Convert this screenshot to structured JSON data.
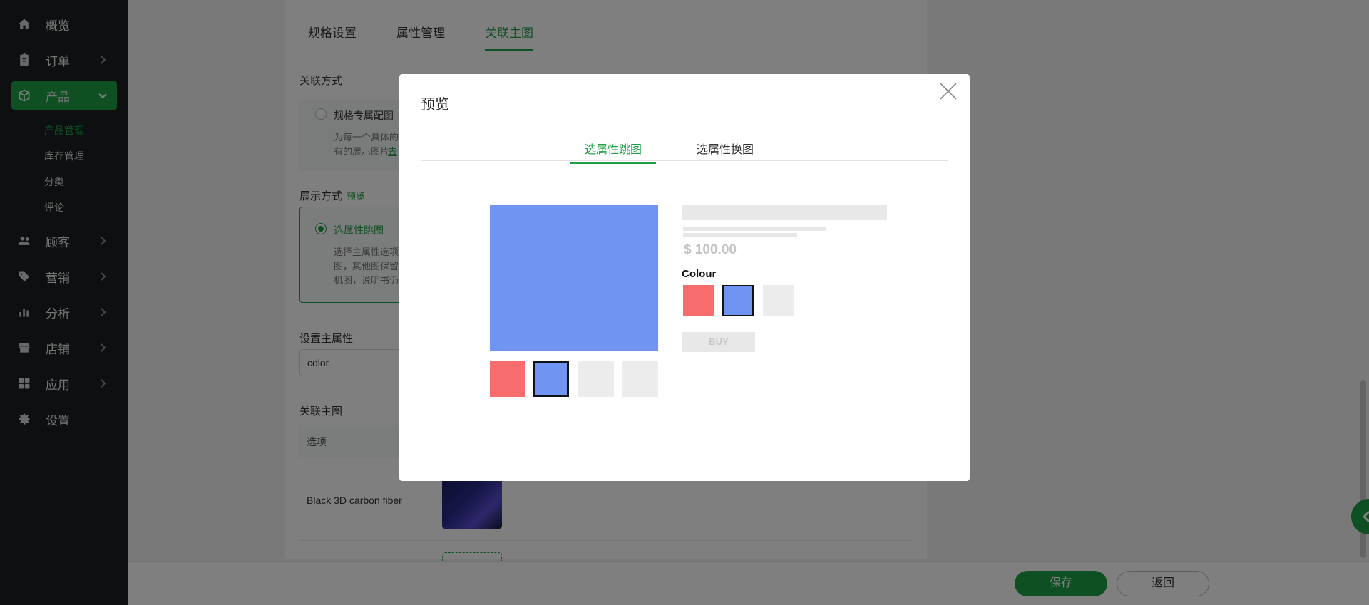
{
  "sidebar": {
    "items": [
      {
        "label": "概览",
        "icon": "home-icon"
      },
      {
        "label": "订单",
        "icon": "clipboard-icon"
      },
      {
        "label": "产品",
        "icon": "box-icon"
      },
      {
        "label": "顾客",
        "icon": "users-icon"
      },
      {
        "label": "营销",
        "icon": "tag-icon"
      },
      {
        "label": "分析",
        "icon": "bar-chart-icon"
      },
      {
        "label": "店铺",
        "icon": "store-icon"
      },
      {
        "label": "应用",
        "icon": "apps-icon"
      },
      {
        "label": "设置",
        "icon": "gear-icon"
      }
    ],
    "product_sub": [
      "产品管理",
      "库存管理",
      "分类",
      "评论"
    ]
  },
  "page": {
    "tabs": [
      "规格设置",
      "属性管理",
      "关联主图"
    ],
    "link_method_title": "关联方式",
    "option_spec_label": "规格专属配图",
    "option_spec_desc1": "为每一个具体的",
    "option_spec_desc2": "有的展示图片",
    "option_spec_link": "去",
    "display_title": "展示方式",
    "display_preview_link": "预览",
    "display_option_label": "选属性跳图",
    "display_desc1": "选择主属性选项",
    "display_desc2": "图，其他图保留",
    "display_desc3": "机图，说明书仍",
    "main_attr_title": "设置主属性",
    "main_attr_value": "color",
    "linked_img_title": "关联主图",
    "table_header": "选项",
    "row_label": "Black 3D carbon fiber"
  },
  "footer": {
    "save": "保存",
    "back": "返回"
  },
  "modal": {
    "title": "预览",
    "tabs": [
      "选属性跳图",
      "选属性换图"
    ],
    "price": "$ 100.00",
    "colour_label": "Colour",
    "buy": "BUY"
  },
  "colors": {
    "accent": "#1fa046",
    "swatch_red": "#f76c6c",
    "swatch_blue": "#7094f2"
  }
}
